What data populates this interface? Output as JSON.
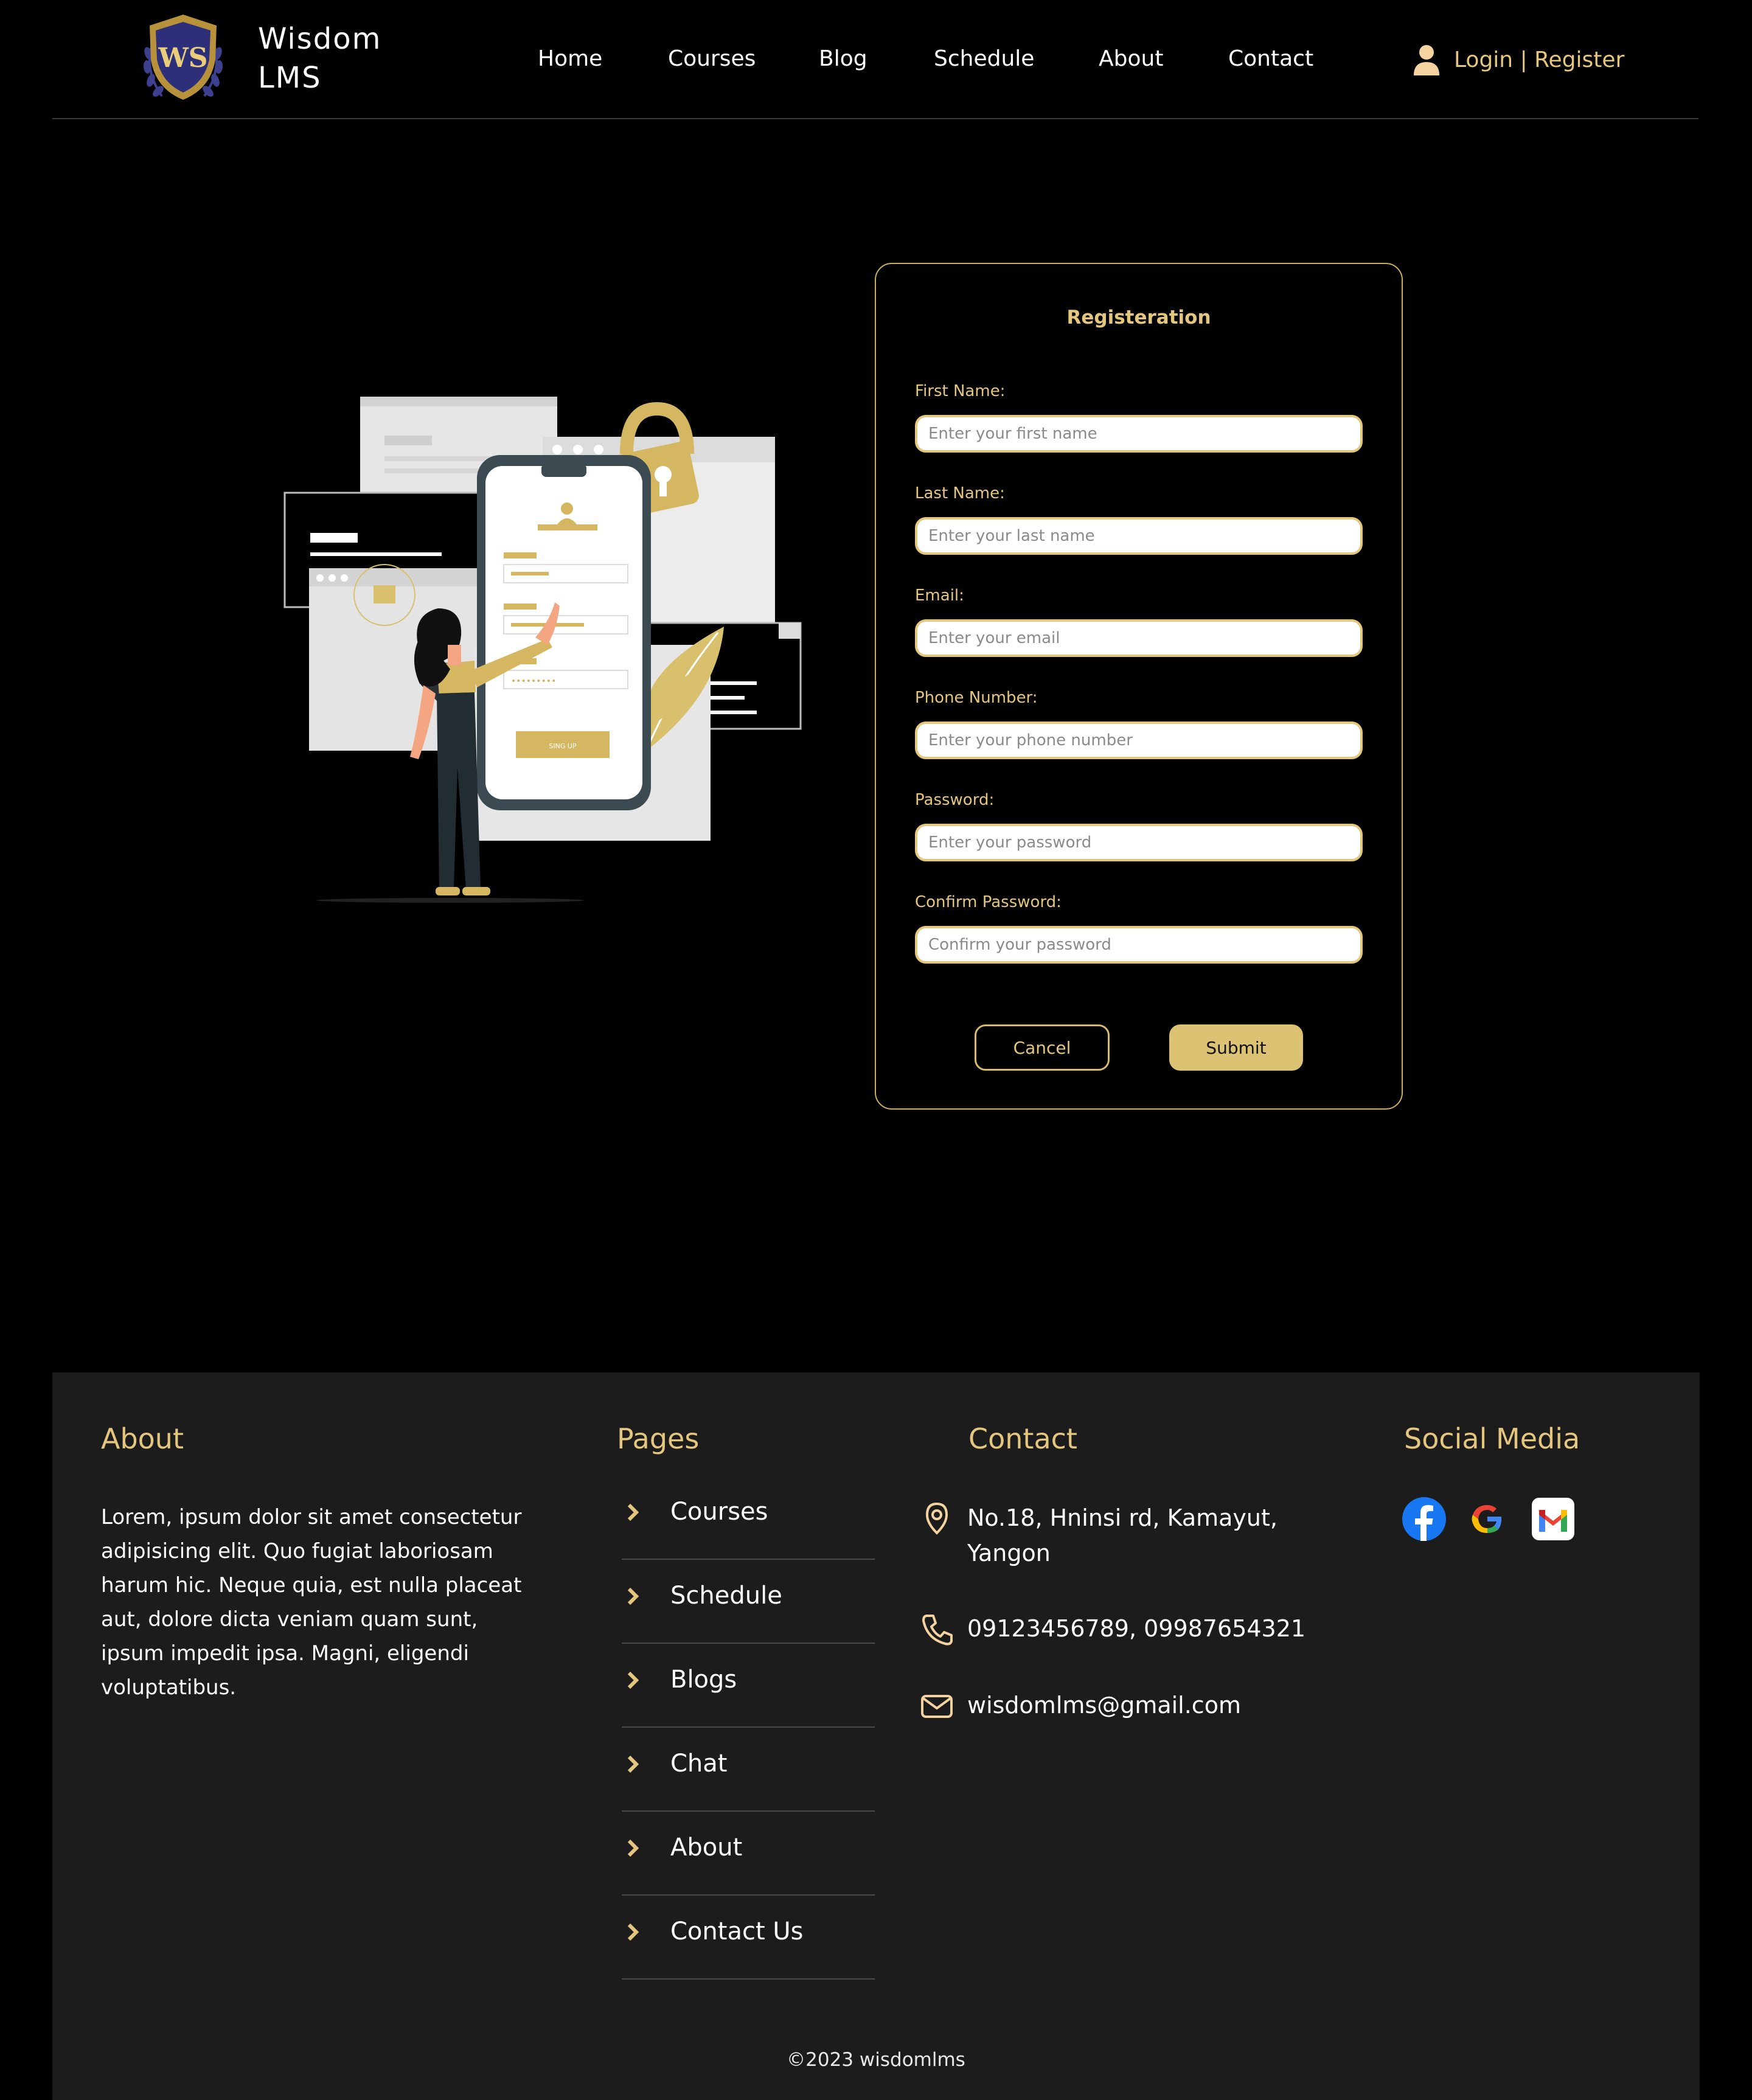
{
  "header": {
    "brand_line1": "Wisdom",
    "brand_line2": "LMS",
    "logo_letters": "WS",
    "nav": [
      "Home",
      "Courses",
      "Blog",
      "Schedule",
      "About",
      "Contact"
    ],
    "login_label": "Login | Register",
    "accent": "#e4c67e"
  },
  "illustration": {
    "signup_button_text": "SING UP",
    "password_mask": "•••••••••"
  },
  "form": {
    "title": "Registeration",
    "fields": [
      {
        "label": "First Name:",
        "placeholder": "Enter your first name"
      },
      {
        "label": "Last Name:",
        "placeholder": "Enter your last name"
      },
      {
        "label": "Email:",
        "placeholder": "Enter your email"
      },
      {
        "label": "Phone Number:",
        "placeholder": "Enter your phone number"
      },
      {
        "label": "Password:",
        "placeholder": "Enter your password"
      },
      {
        "label": "Confirm Password:",
        "placeholder": "Confirm your password"
      }
    ],
    "cancel_label": "Cancel",
    "submit_label": "Submit"
  },
  "footer": {
    "about_heading": "About",
    "about_text": "Lorem, ipsum dolor sit amet consectetur adipisicing elit. Quo fugiat laboriosam harum hic. Neque quia, est nulla placeat aut, dolore dicta veniam quam sunt, ipsum impedit ipsa. Magni, eligendi voluptatibus.",
    "pages_heading": "Pages",
    "pages": [
      "Courses",
      "Schedule",
      "Blogs",
      "Chat",
      "About",
      "Contact Us"
    ],
    "contact_heading": "Contact",
    "address": "No.18, Hninsi rd, Kamayut, Yangon",
    "phone": "09123456789, 09987654321",
    "email": "wisdomlms@gmail.com",
    "social_heading": "Social Media",
    "social_icons": [
      "facebook-icon",
      "google-icon",
      "gmail-icon"
    ],
    "copyright": "©2023 wisdomlms",
    "background": "#1c1c1c"
  }
}
